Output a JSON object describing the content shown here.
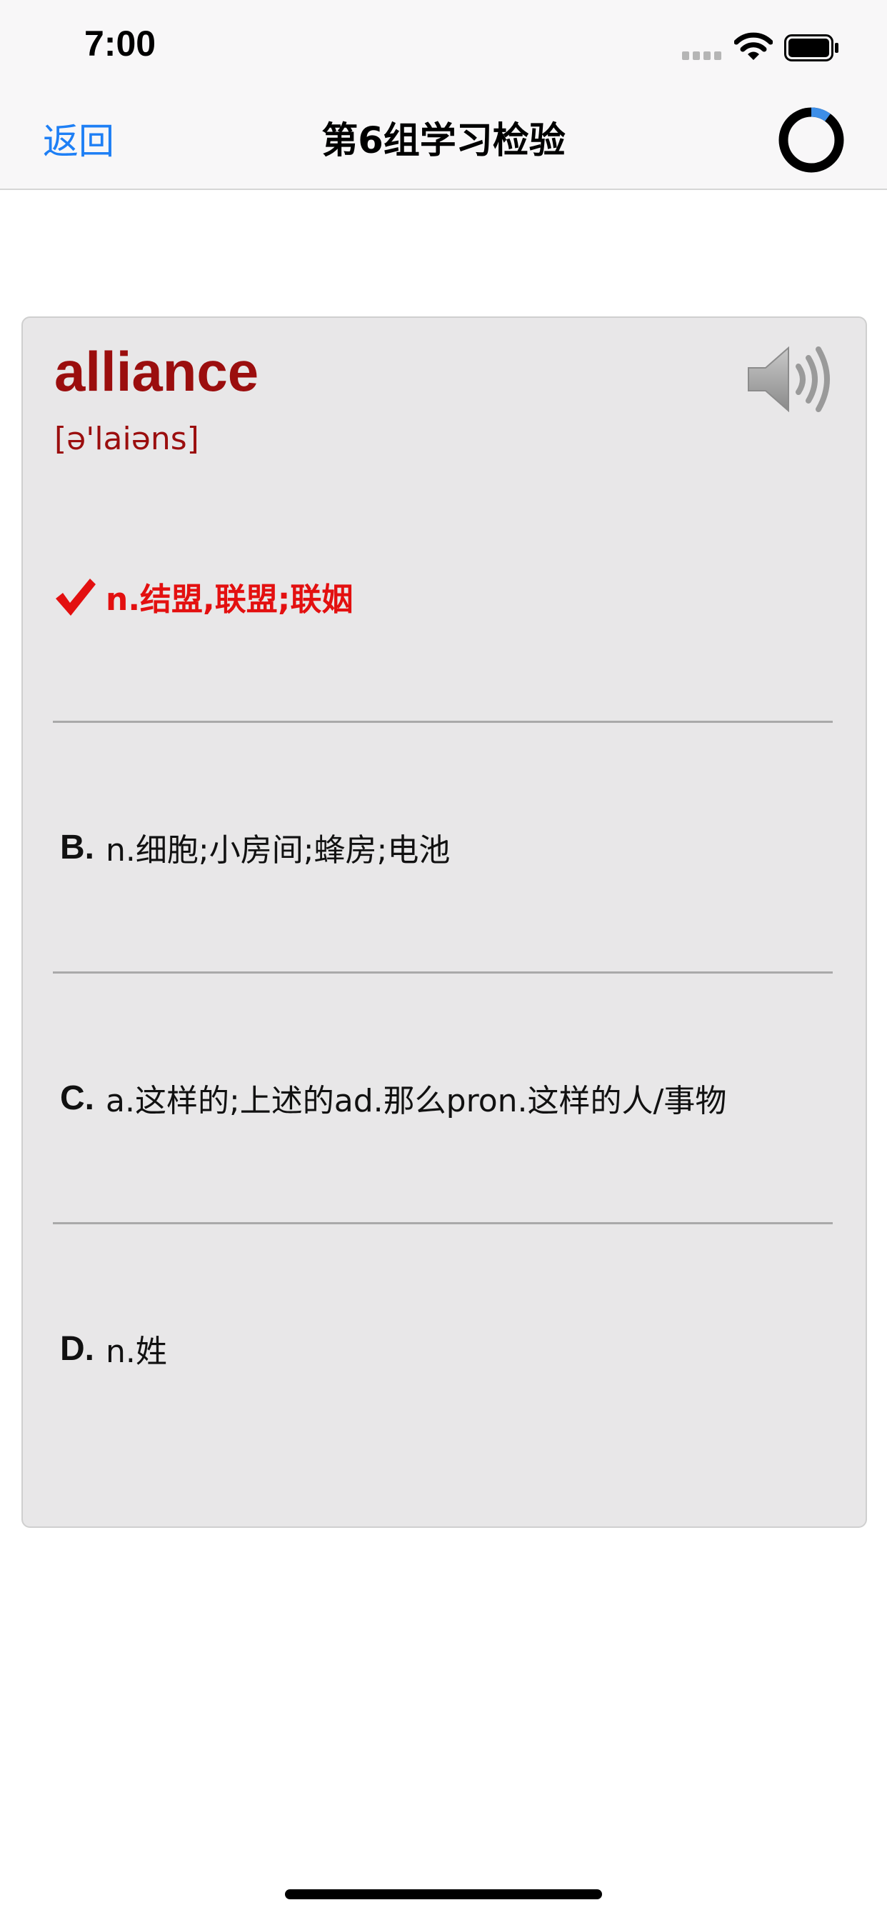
{
  "status_bar": {
    "time": "7:00"
  },
  "nav": {
    "back_label": "返回",
    "title": "第6组学习检验",
    "progress_fraction": 0.1
  },
  "word": {
    "text": "alliance",
    "phonetic": "[ə'laiəns]"
  },
  "options": [
    {
      "letter": "",
      "text": "n.结盟,联盟;联姻",
      "state": "correct"
    },
    {
      "letter": "B.",
      "text": "n.细胞;小房间;蜂房;电池",
      "state": "normal"
    },
    {
      "letter": "C.",
      "text": "a.这样的;上述的ad.那么pron.这样的人/事物",
      "state": "normal"
    },
    {
      "letter": "D.",
      "text": "n.姓",
      "state": "normal"
    }
  ],
  "colors": {
    "accent": "#1e7ff5",
    "word": "#9b0e0e",
    "correct": "#e31010",
    "card_bg": "#e8e7e8"
  },
  "icons": {
    "check": "check-icon",
    "speaker": "speaker-icon",
    "progress": "progress-ring-icon"
  }
}
